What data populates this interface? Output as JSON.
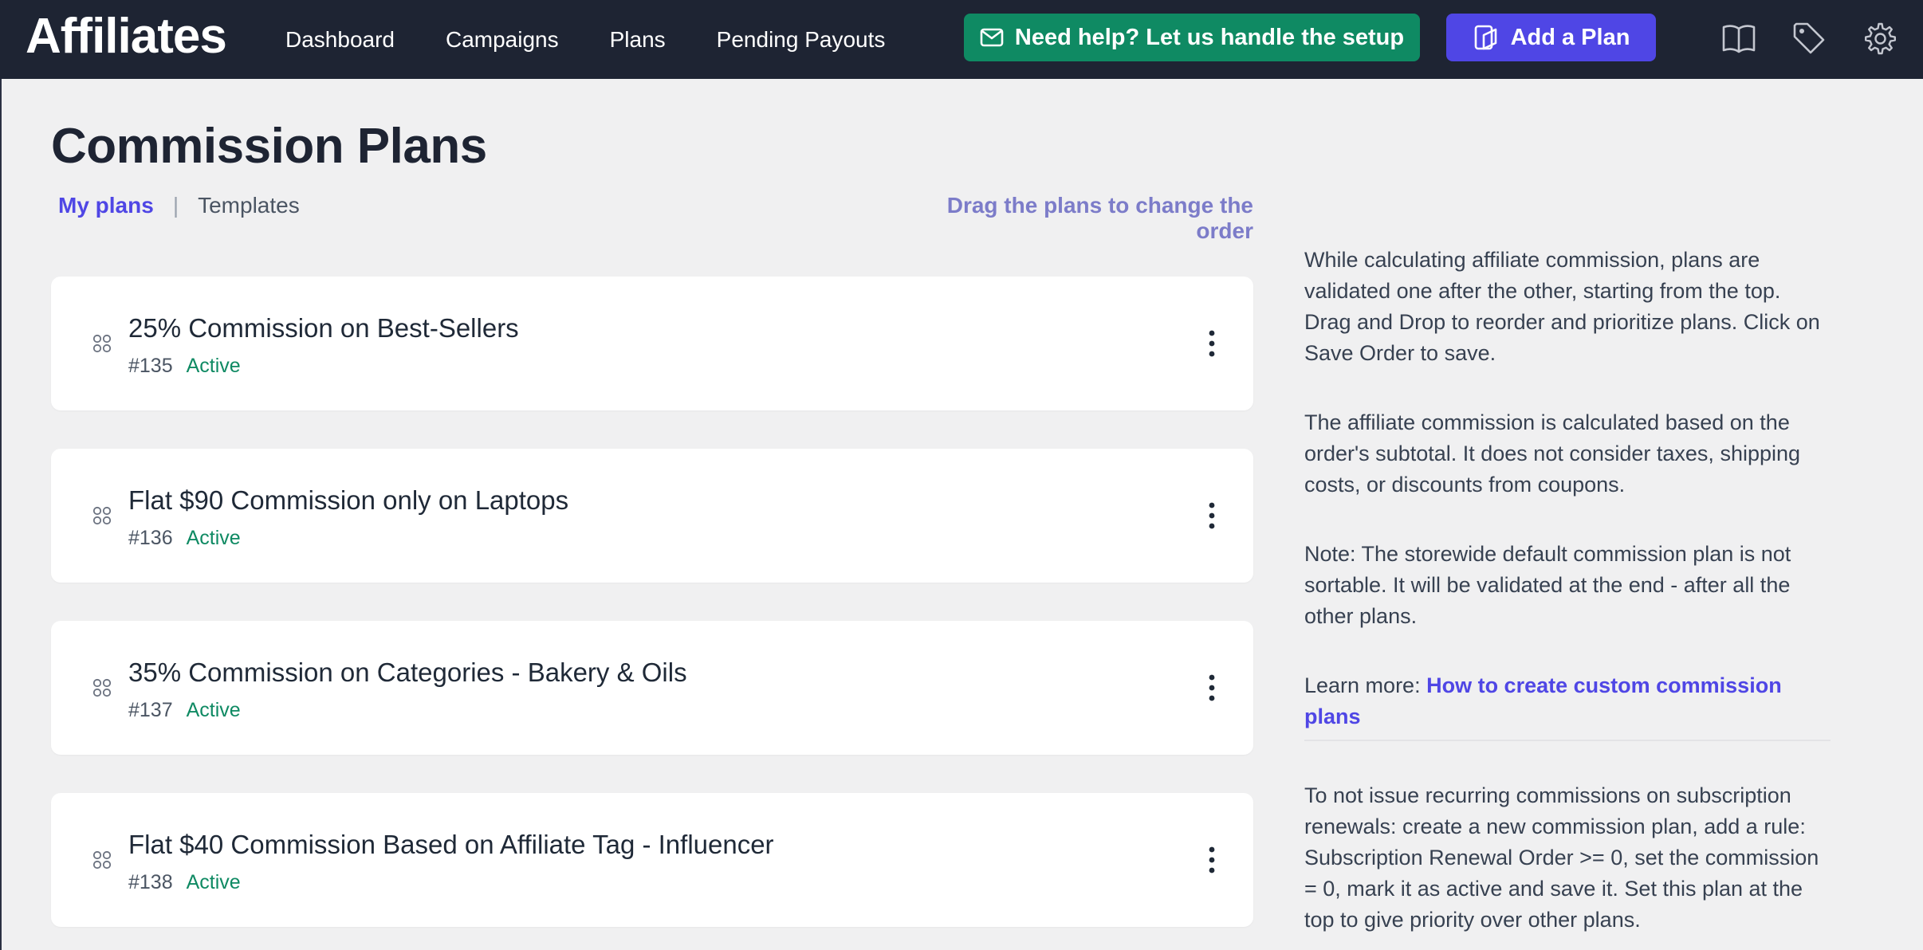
{
  "app": {
    "brand": "Affiliates"
  },
  "nav": {
    "items": [
      "Dashboard",
      "Campaigns",
      "Plans",
      "Pending Payouts"
    ]
  },
  "actions": {
    "help_label": "Need help? Let us handle the setup",
    "add_plan_label": "Add a Plan"
  },
  "icons": {
    "help": "mail-icon",
    "add_plan": "add-plan-icon",
    "docs": "book-icon",
    "tags": "tag-icon",
    "settings": "gear-icon"
  },
  "colors": {
    "topbar": "#1e2433",
    "help_button": "#0f8a63",
    "primary": "#4f46e5",
    "status_active": "#0f8a63"
  },
  "page": {
    "title": "Commission Plans",
    "tabs": {
      "active": "My plans",
      "separator": "|",
      "other": "Templates"
    },
    "drag_hint": "Drag the plans to change the order"
  },
  "plans": [
    {
      "title": "25% Commission on Best-Sellers",
      "id": "#135",
      "status": "Active"
    },
    {
      "title": "Flat $90 Commission only on Laptops",
      "id": "#136",
      "status": "Active"
    },
    {
      "title": "35% Commission on Categories - Bakery & Oils",
      "id": "#137",
      "status": "Active"
    },
    {
      "title": "Flat $40 Commission Based on Affiliate Tag - Influencer",
      "id": "#138",
      "status": "Active"
    }
  ],
  "info": {
    "p1": "While calculating affiliate commission, plans are validated one after the other, starting from the top. Drag and Drop to reorder and prioritize plans. Click on Save Order to save.",
    "p2": "The affiliate commission is calculated based on the order's subtotal. It does not consider taxes, shipping costs, or discounts from coupons.",
    "p3": "Note: The storewide default commission plan is not sortable. It will be validated at the end - after all the other plans.",
    "learn_prefix": "Learn more: ",
    "learn_link": "How to create custom commission plans",
    "p4": "To not issue recurring commissions on subscription renewals: create a new commission plan, add a rule: Subscription Renewal Order >= 0, set the commission = 0, mark it as active and save it. Set this plan at the top to give priority over other plans."
  }
}
